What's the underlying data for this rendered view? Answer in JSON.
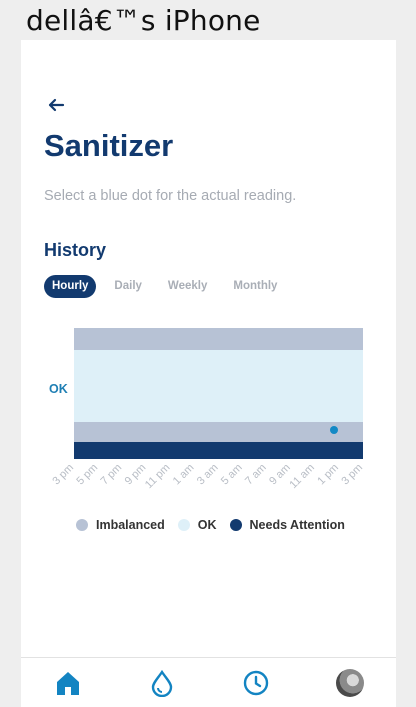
{
  "device": {
    "title": "dellâ€™s iPhone"
  },
  "page": {
    "title": "Sanitizer",
    "subtitle": "Select a blue dot for the actual reading."
  },
  "history": {
    "heading": "History",
    "tabs": [
      {
        "label": "Hourly",
        "active": true
      },
      {
        "label": "Daily",
        "active": false
      },
      {
        "label": "Weekly",
        "active": false
      },
      {
        "label": "Monthly",
        "active": false
      }
    ]
  },
  "colors": {
    "brand": "#123a6f",
    "imbalanced": "#b7c2d5",
    "ok": "#def0f8",
    "needs_attention": "#123a6f",
    "reading": "#1389c5"
  },
  "chart_data": {
    "type": "scatter",
    "band_labels": [
      "OK"
    ],
    "bands_top_to_bottom": [
      {
        "name": "Imbalanced",
        "color": "#b7c2d5"
      },
      {
        "name": "OK",
        "color": "#def0f8"
      },
      {
        "name": "Imbalanced",
        "color": "#b7c2d5"
      },
      {
        "name": "Needs Attention",
        "color": "#123a6f"
      }
    ],
    "x_tick_labels": [
      "3 pm",
      "5 pm",
      "7 pm",
      "9 pm",
      "11 pm",
      "1 am",
      "3 am",
      "5 am",
      "7 am",
      "9 am",
      "11 am",
      "1 pm",
      "3 pm"
    ],
    "points": [
      {
        "x": "between 1 pm and 3 pm",
        "band": "Imbalanced (lower)"
      }
    ],
    "legend": [
      {
        "label": "Imbalanced",
        "color": "#b7c2d5"
      },
      {
        "label": "OK",
        "color": "#def0f8"
      },
      {
        "label": "Needs Attention",
        "color": "#123a6f"
      }
    ]
  },
  "nav": {
    "items": [
      {
        "icon": "home-icon",
        "active": true
      },
      {
        "icon": "water-drop-icon",
        "active": false
      },
      {
        "icon": "clock-icon",
        "active": false
      },
      {
        "icon": "avatar",
        "active": false
      }
    ]
  }
}
